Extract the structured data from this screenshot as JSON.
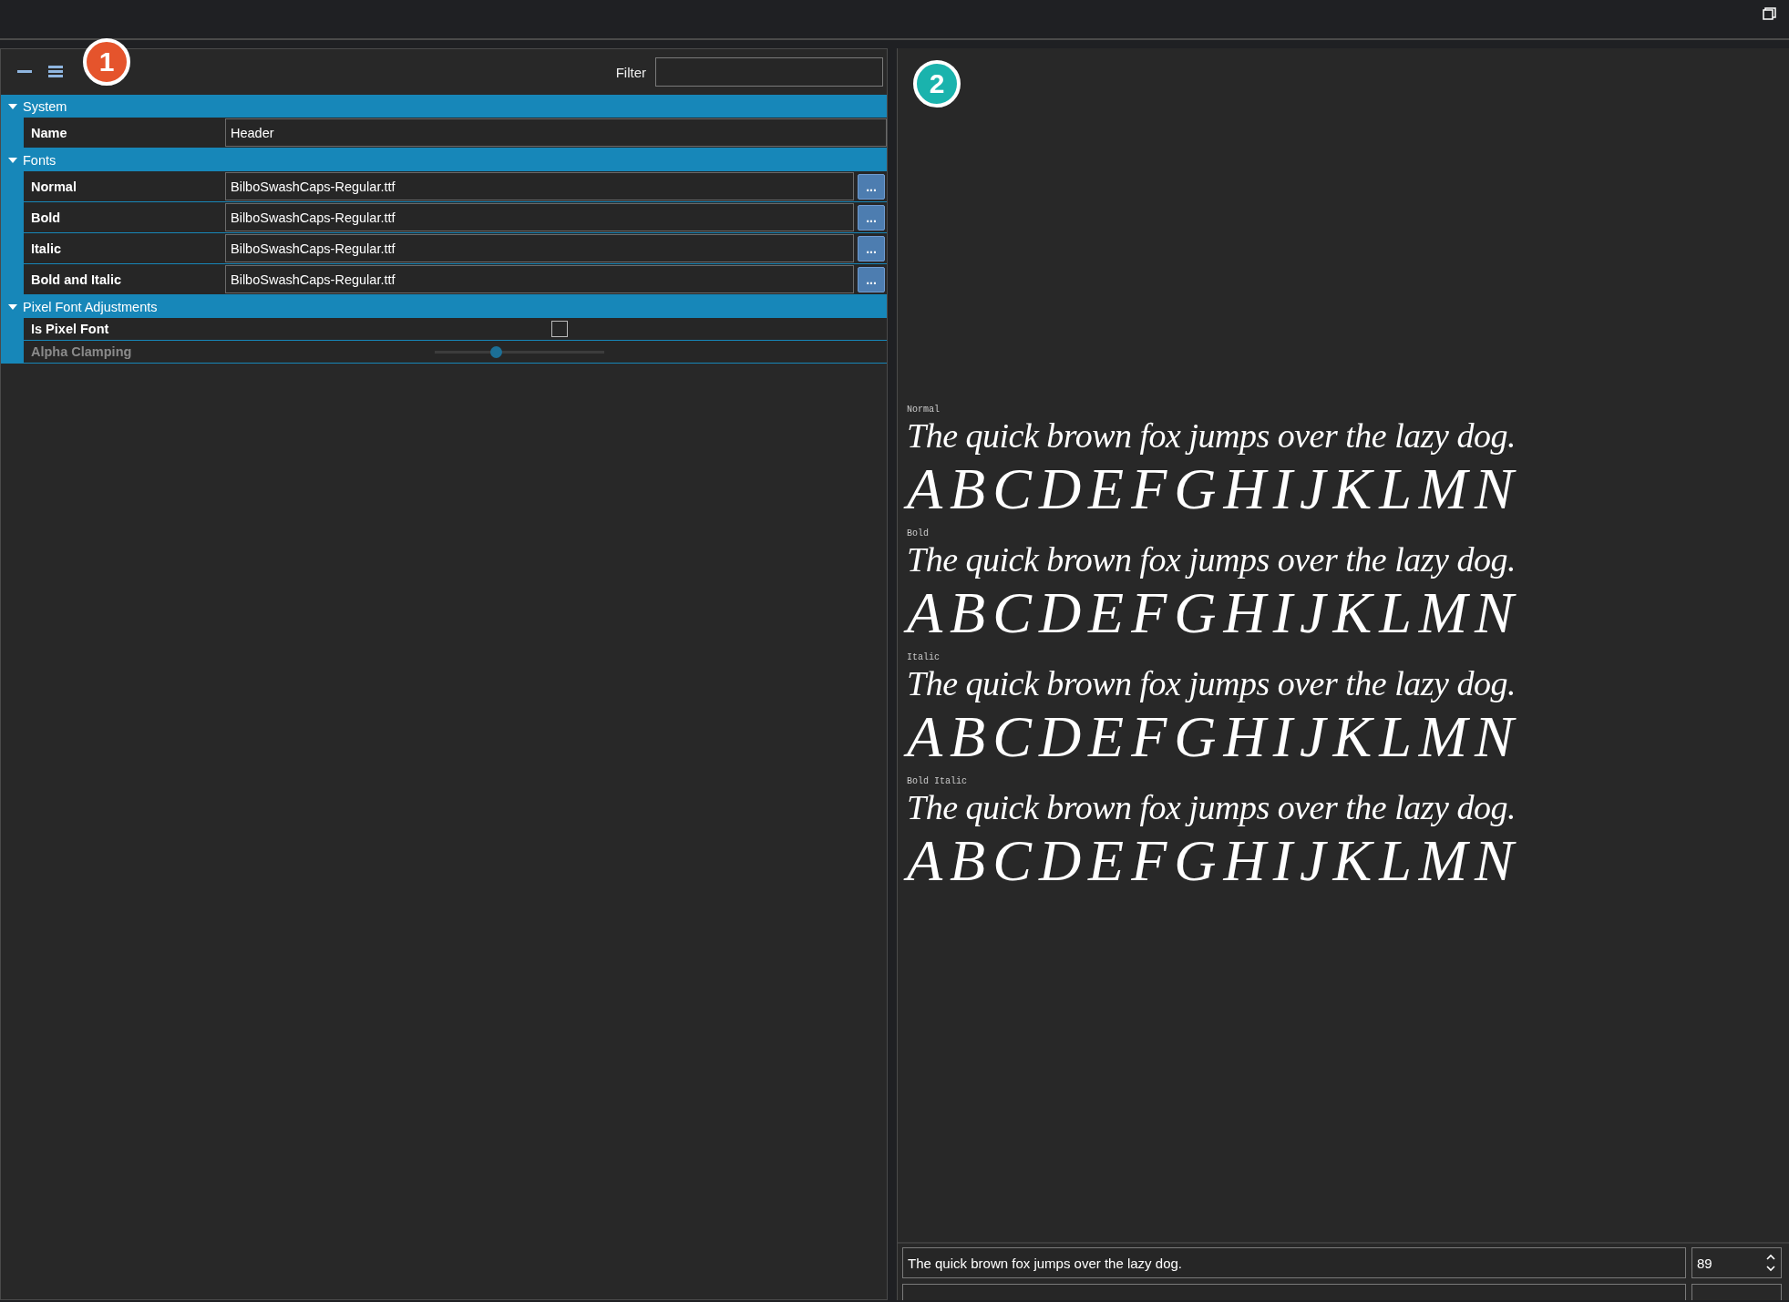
{
  "property_panel": {
    "badge": "1",
    "filter": {
      "label": "Filter"
    },
    "groups": [
      {
        "name": "System",
        "expanded": true,
        "properties": [
          {
            "kind": "text",
            "label": "Name",
            "value": "Header"
          }
        ]
      },
      {
        "name": "Fonts",
        "expanded": true,
        "properties": [
          {
            "kind": "file",
            "label": "Normal",
            "value": "BilboSwashCaps-Regular.ttf",
            "button": "..."
          },
          {
            "kind": "file",
            "label": "Bold",
            "value": "BilboSwashCaps-Regular.ttf",
            "button": "..."
          },
          {
            "kind": "file",
            "label": "Italic",
            "value": "BilboSwashCaps-Regular.ttf",
            "button": "..."
          },
          {
            "kind": "file",
            "label": "Bold and Italic",
            "value": "BilboSwashCaps-Regular.ttf",
            "button": "..."
          }
        ]
      },
      {
        "name": "Pixel Font Adjustments",
        "expanded": true,
        "properties": [
          {
            "kind": "checkbox",
            "label": "Is Pixel Font",
            "checked": false,
            "disabled": false
          },
          {
            "kind": "slider",
            "label": "Alpha Clamping",
            "level": 0.36,
            "disabled": true
          }
        ]
      }
    ]
  },
  "preview": {
    "badge": "2",
    "samples": [
      {
        "label": "Normal",
        "sentence": "The quick brown fox jumps over the lazy dog.",
        "alphabet": "ABCDEFGHIJKLMN"
      },
      {
        "label": "Bold",
        "sentence": "The quick brown fox jumps over the lazy dog.",
        "alphabet": "ABCDEFGHIJKLMN"
      },
      {
        "label": "Italic",
        "sentence": "The quick brown fox jumps over the lazy dog.",
        "alphabet": "ABCDEFGHIJKLMN"
      },
      {
        "label": "Bold Italic",
        "sentence": "The quick brown fox jumps over the lazy dog.",
        "alphabet": "ABCDEFGHIJKLMN"
      }
    ],
    "sample_text": {
      "value": "The quick brown fox jumps over the lazy dog."
    },
    "size": {
      "value": "89"
    }
  }
}
